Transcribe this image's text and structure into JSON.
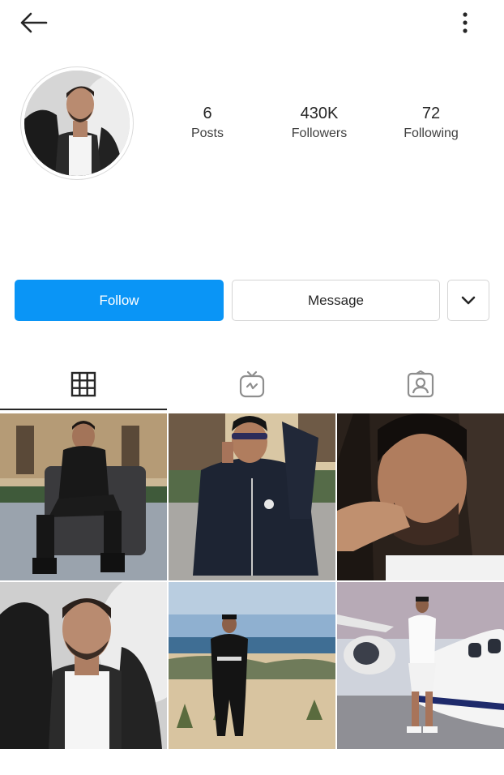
{
  "header": {
    "back_icon": "arrow-left-icon",
    "menu_icon": "more-vertical-icon"
  },
  "profile": {
    "avatar_icon": "profile-photo"
  },
  "stats": [
    {
      "value": "6",
      "label": "Posts"
    },
    {
      "value": "430K",
      "label": "Followers"
    },
    {
      "value": "72",
      "label": "Following"
    }
  ],
  "actions": {
    "follow": "Follow",
    "message": "Message",
    "more_icon": "chevron-down-icon"
  },
  "tabs": [
    {
      "icon": "grid-icon",
      "active": true
    },
    {
      "icon": "igtv-icon",
      "active": false
    },
    {
      "icon": "tagged-icon",
      "active": false
    }
  ],
  "colors": {
    "follow_blue": "#0a95f6",
    "text": "#262626",
    "border": "#d4d4d4"
  },
  "posts": [
    {
      "name": "post-man-sitting-armchair"
    },
    {
      "name": "post-man-phone-hoodie"
    },
    {
      "name": "post-man-closeup-hand"
    },
    {
      "name": "post-man-blurred-portrait"
    },
    {
      "name": "post-man-beach-dunes"
    },
    {
      "name": "post-man-private-jet"
    }
  ]
}
